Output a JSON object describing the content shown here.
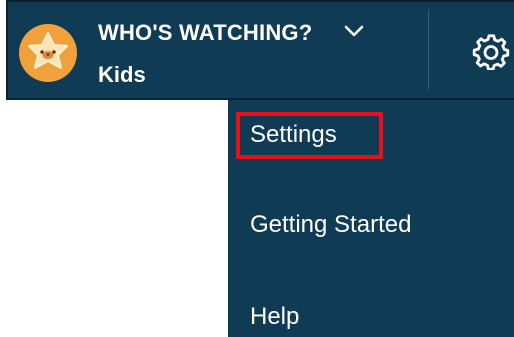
{
  "header": {
    "who_label": "WHO'S WATCHING?",
    "profile_name": "Kids",
    "avatar_icon": "star-face-avatar-icon",
    "dropdown_icon": "chevron-down-icon",
    "settings_icon": "gear-icon"
  },
  "menu": {
    "items": [
      {
        "label": "Settings",
        "highlighted": true
      },
      {
        "label": "Getting Started",
        "highlighted": false
      },
      {
        "label": "Help",
        "highlighted": false
      }
    ]
  },
  "colors": {
    "bar_background": "#0f3b55",
    "text": "#ffffff",
    "avatar_orange": "#f0a139",
    "highlight_red": "#e8111b"
  }
}
